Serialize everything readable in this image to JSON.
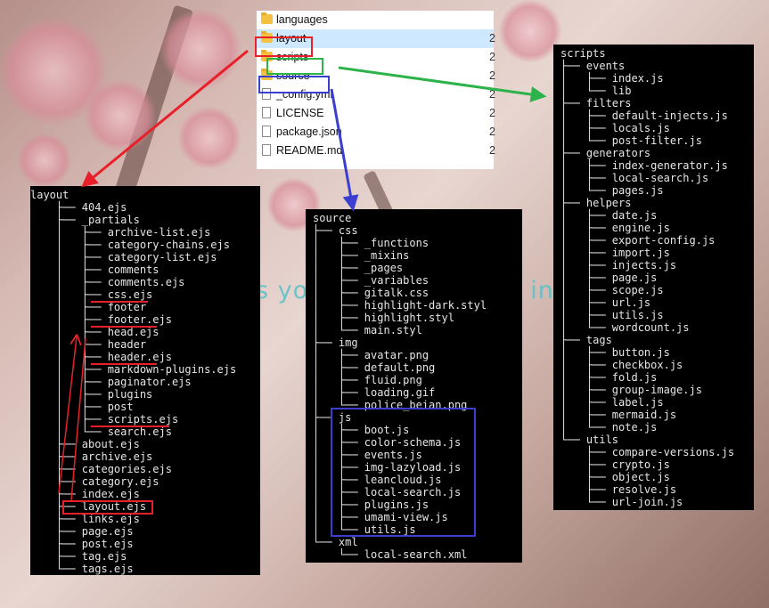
{
  "background_text": "s yo                          in",
  "explorer": {
    "items": [
      {
        "label": "languages",
        "icon": "folder-icon",
        "trunc": ""
      },
      {
        "label": "layout",
        "icon": "folder-icon",
        "trunc": "2",
        "selected": true
      },
      {
        "label": "scripts",
        "icon": "folder-icon",
        "trunc": "2"
      },
      {
        "label": "source",
        "icon": "folder-icon",
        "trunc": "2"
      },
      {
        "label": "_config.yml",
        "icon": "file-icon",
        "trunc": "2"
      },
      {
        "label": "LICENSE",
        "icon": "file-icon",
        "trunc": "2"
      },
      {
        "label": "package.json",
        "icon": "file-icon",
        "trunc": "2"
      },
      {
        "label": "README.md",
        "icon": "file-icon",
        "trunc": "2"
      }
    ]
  },
  "layout_tree": [
    "layout",
    "    ├── 404.ejs",
    "    ├── _partials",
    "    │   ├── archive-list.ejs",
    "    │   ├── category-chains.ejs",
    "    │   ├── category-list.ejs",
    "    │   ├── comments",
    "    │   ├── comments.ejs",
    "    │   ├── css.ejs",
    "    │   ├── footer",
    "    │   ├── footer.ejs",
    "    │   ├── head.ejs",
    "    │   ├── header",
    "    │   ├── header.ejs",
    "    │   ├── markdown-plugins.ejs",
    "    │   ├── paginator.ejs",
    "    │   ├── plugins",
    "    │   ├── post",
    "    │   ├── scripts.ejs",
    "    │   └── search.ejs",
    "    ├── about.ejs",
    "    ├── archive.ejs",
    "    ├── categories.ejs",
    "    ├── category.ejs",
    "    ├── index.ejs",
    "    ├── layout.ejs",
    "    ├── links.ejs",
    "    ├── page.ejs",
    "    ├── post.ejs",
    "    ├── tag.ejs",
    "    └── tags.ejs"
  ],
  "source_tree": [
    "source",
    "├── css",
    "│   ├── _functions",
    "│   ├── _mixins",
    "│   ├── _pages",
    "│   ├── _variables",
    "│   ├── gitalk.css",
    "│   ├── highlight-dark.styl",
    "│   ├── highlight.styl",
    "│   └── main.styl",
    "├── img",
    "│   ├── avatar.png",
    "│   ├── default.png",
    "│   ├── fluid.png",
    "│   ├── loading.gif",
    "│   └── police_beian.png",
    "├── js",
    "│   ├── boot.js",
    "│   ├── color-schema.js",
    "│   ├── events.js",
    "│   ├── img-lazyload.js",
    "│   ├── leancloud.js",
    "│   ├── local-search.js",
    "│   ├── plugins.js",
    "│   ├── umami-view.js",
    "│   └── utils.js",
    "└── xml",
    "    └── local-search.xml"
  ],
  "scripts_tree": [
    "scripts",
    "├── events",
    "│   ├── index.js",
    "│   └── lib",
    "├── filters",
    "│   ├── default-injects.js",
    "│   ├── locals.js",
    "│   └── post-filter.js",
    "├── generators",
    "│   ├── index-generator.js",
    "│   ├── local-search.js",
    "│   └── pages.js",
    "├── helpers",
    "│   ├── date.js",
    "│   ├── engine.js",
    "│   ├── export-config.js",
    "│   ├── import.js",
    "│   ├── injects.js",
    "│   ├── page.js",
    "│   ├── scope.js",
    "│   ├── url.js",
    "│   ├── utils.js",
    "│   └── wordcount.js",
    "├── tags",
    "│   ├── button.js",
    "│   ├── checkbox.js",
    "│   ├── fold.js",
    "│   ├── group-image.js",
    "│   ├── label.js",
    "│   ├── mermaid.js",
    "│   └── note.js",
    "└── utils",
    "    ├── compare-versions.js",
    "    ├── crypto.js",
    "    ├── object.js",
    "    ├── resolve.js",
    "    └── url-join.js"
  ],
  "colors": {
    "red": "#e8202a",
    "green": "#2db34a",
    "blue": "#3b3fd0"
  }
}
